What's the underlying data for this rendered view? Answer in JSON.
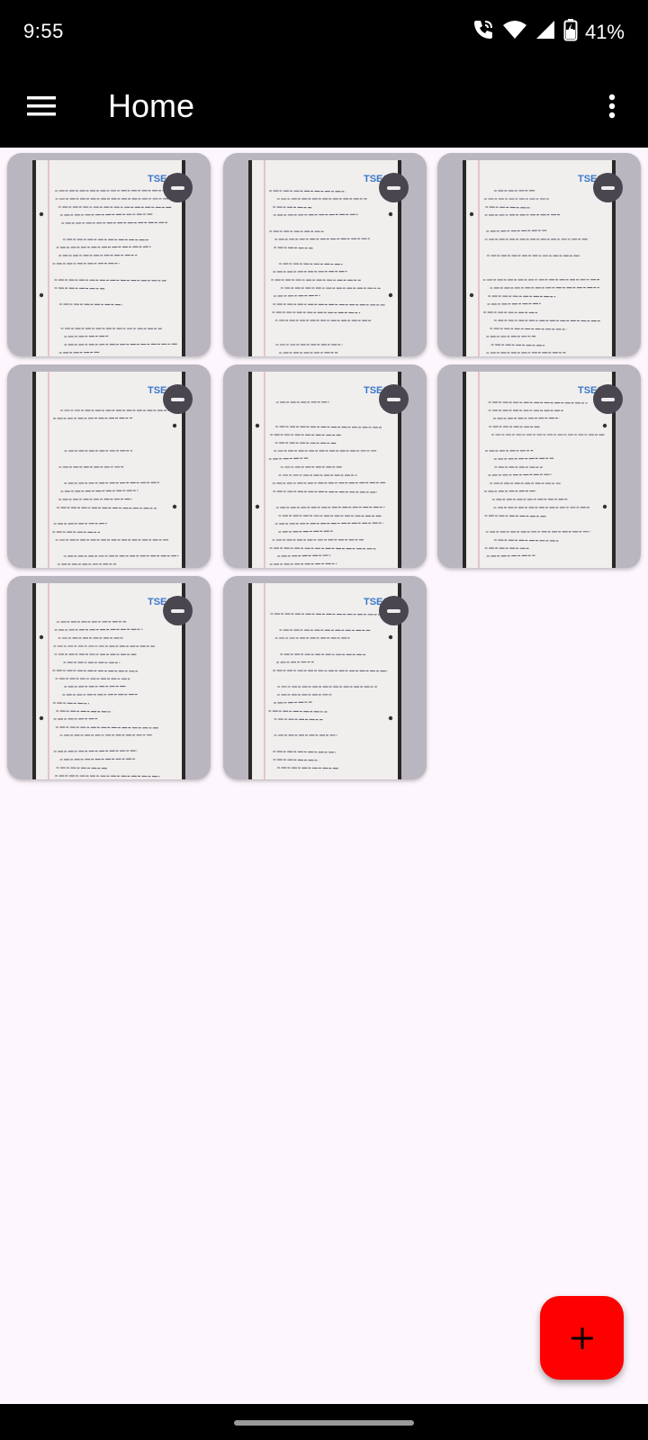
{
  "status_bar": {
    "time": "9:55",
    "battery_percent": "41%",
    "icons": [
      "wifi-calling-icon",
      "wifi-icon",
      "cell-signal-icon",
      "battery-charging-icon"
    ]
  },
  "app_bar": {
    "title": "Home",
    "menu_icon": "hamburger-menu-icon",
    "more_icon": "more-vert-icon"
  },
  "documents": [
    {
      "id": 1,
      "header": "TSEC"
    },
    {
      "id": 2,
      "header": "TSEC"
    },
    {
      "id": 3,
      "header": "TSEC"
    },
    {
      "id": 4,
      "header": "TSEC"
    },
    {
      "id": 5,
      "header": "TSEC"
    },
    {
      "id": 6,
      "header": "TSEC"
    },
    {
      "id": 7,
      "header": "TSEC"
    },
    {
      "id": 8,
      "header": "TSEC"
    }
  ],
  "fab": {
    "icon": "add-icon"
  },
  "colors": {
    "bars": "#000000",
    "background": "#fdf7fd",
    "card": "#b9b6bf",
    "fab": "#ff0000",
    "tsec_blue": "#3a78c8"
  }
}
